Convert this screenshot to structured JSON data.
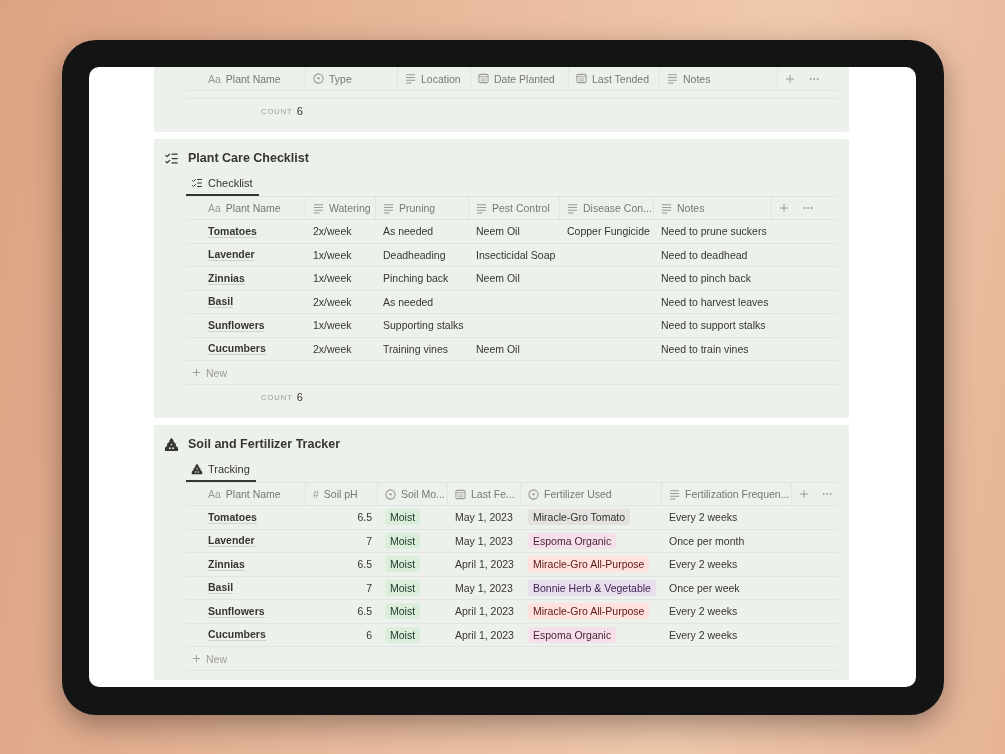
{
  "sections": [
    {
      "columns": [
        {
          "kind": "title",
          "icon_text": "Aa",
          "label": "Plant Name"
        },
        {
          "kind": "select",
          "label": "Type"
        },
        {
          "kind": "text",
          "label": "Location"
        },
        {
          "kind": "date",
          "label": "Date Planted"
        },
        {
          "kind": "date",
          "label": "Last Tended"
        },
        {
          "kind": "text",
          "label": "Notes"
        }
      ],
      "count": {
        "label": "COUNT",
        "value": "6"
      }
    },
    {
      "kind": "checklist",
      "title": "Plant Care Checklist",
      "tab": {
        "label": "Checklist",
        "selected": true
      },
      "columns": [
        {
          "kind": "title",
          "icon_text": "Aa",
          "label": "Plant Name"
        },
        {
          "kind": "text",
          "label": "Watering"
        },
        {
          "kind": "text",
          "label": "Pruning"
        },
        {
          "kind": "text",
          "label": "Pest Control"
        },
        {
          "kind": "text",
          "label": "Disease Con..."
        },
        {
          "kind": "text",
          "label": "Notes"
        }
      ],
      "rows": [
        {
          "cells": [
            "Tomatoes",
            "2x/week",
            "As needed",
            "Neem Oil",
            "Copper Fungicide",
            "Need to prune suckers"
          ]
        },
        {
          "cells": [
            "Lavender",
            "1x/week",
            "Deadheading",
            "Insecticidal Soap",
            "",
            "Need to deadhead"
          ]
        },
        {
          "cells": [
            "Zinnias",
            "1x/week",
            "Pinching back",
            "Neem Oil",
            "",
            "Need to pinch back"
          ]
        },
        {
          "cells": [
            "Basil",
            "2x/week",
            "As needed",
            "",
            "",
            "Need to harvest leaves"
          ]
        },
        {
          "cells": [
            "Sunflowers",
            "1x/week",
            "Supporting stalks",
            "",
            "",
            "Need to support stalks"
          ]
        },
        {
          "cells": [
            "Cucumbers",
            "2x/week",
            "Training vines",
            "Neem Oil",
            "",
            "Need to train vines"
          ]
        }
      ],
      "new_label": "New",
      "count": {
        "label": "COUNT",
        "value": "6"
      }
    },
    {
      "kind": "tracker",
      "title": "Soil and Fertilizer Tracker",
      "tab": {
        "label": "Tracking",
        "selected": true
      },
      "columns": [
        {
          "kind": "title",
          "icon_text": "Aa",
          "label": "Plant Name"
        },
        {
          "kind": "number",
          "icon_text": "#",
          "label": "Soil pH"
        },
        {
          "kind": "select",
          "label": "Soil Mo..."
        },
        {
          "kind": "date",
          "label": "Last Fe..."
        },
        {
          "kind": "select",
          "label": "Fertilizer Used"
        },
        {
          "kind": "text",
          "label": "Fertilization Frequen..."
        }
      ],
      "rows": [
        {
          "cells": [
            "Tomatoes",
            "6.5",
            {
              "tag": "Moist",
              "color": "#dbeddb"
            },
            "May 1, 2023",
            {
              "tag": "Miracle-Gro Tomato",
              "color": "#e3e2e0"
            },
            "Every 2 weeks"
          ]
        },
        {
          "cells": [
            "Lavender",
            "7",
            {
              "tag": "Moist",
              "color": "#dbeddb"
            },
            "May 1, 2023",
            {
              "tag": "Espoma Organic",
              "color": "#f5e0e9"
            },
            "Once per month"
          ]
        },
        {
          "cells": [
            "Zinnias",
            "6.5",
            {
              "tag": "Moist",
              "color": "#dbeddb"
            },
            "April 1, 2023",
            {
              "tag": "Miracle-Gro All-Purpose",
              "color": "#ffe2dd"
            },
            "Every 2 weeks"
          ]
        },
        {
          "cells": [
            "Basil",
            "7",
            {
              "tag": "Moist",
              "color": "#dbeddb"
            },
            "May 1, 2023",
            {
              "tag": "Bonnie Herb & Vegetable",
              "color": "#e8deee"
            },
            "Once per week"
          ]
        },
        {
          "cells": [
            "Sunflowers",
            "6.5",
            {
              "tag": "Moist",
              "color": "#dbeddb"
            },
            "April 1, 2023",
            {
              "tag": "Miracle-Gro All-Purpose",
              "color": "#ffe2dd"
            },
            "Every 2 weeks"
          ]
        },
        {
          "cells": [
            "Cucumbers",
            "6",
            {
              "tag": "Moist",
              "color": "#dbeddb"
            },
            "April 1, 2023",
            {
              "tag": "Espoma Organic",
              "color": "#f5e0e9"
            },
            "Every 2 weeks"
          ]
        }
      ],
      "new_label": "New"
    }
  ]
}
